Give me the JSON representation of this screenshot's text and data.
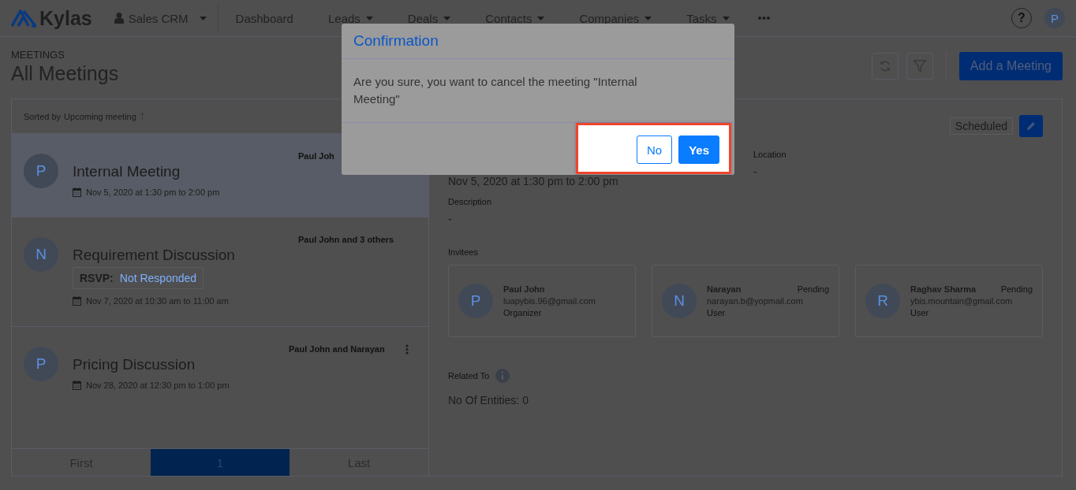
{
  "brand": {
    "name": "Kylas"
  },
  "workspace": {
    "label": "Sales CRM"
  },
  "nav": [
    {
      "label": "Dashboard",
      "dropdown": false
    },
    {
      "label": "Leads",
      "dropdown": true
    },
    {
      "label": "Deals",
      "dropdown": true
    },
    {
      "label": "Contacts",
      "dropdown": true
    },
    {
      "label": "Companies",
      "dropdown": true
    },
    {
      "label": "Tasks",
      "dropdown": true
    }
  ],
  "help": "?",
  "user": {
    "initial": "P"
  },
  "page": {
    "section": "MEETINGS",
    "title": "All Meetings",
    "add_button": "Add a Meeting"
  },
  "list": {
    "sort_label": "Sorted by",
    "sort_value": "Upcoming meeting",
    "meetings": [
      {
        "initial": "P",
        "title": "Internal Meeting",
        "participants": "Paul Joh",
        "date": "Nov 5, 2020 at 1:30 pm to 2:00 pm",
        "selected": true,
        "menu": false
      },
      {
        "initial": "N",
        "title": "Requirement Discussion",
        "participants": "Paul John and 3 others",
        "rsvp_label": "RSVP:",
        "rsvp_value": "Not Responded",
        "date": "Nov 7, 2020 at 10:30 am to 11:00 am",
        "selected": false,
        "menu": false
      },
      {
        "initial": "P",
        "title": "Pricing Discussion",
        "participants": "Paul John and Narayan",
        "date": "Nov 28, 2020 at 12:30 pm to 1:00 pm",
        "selected": false,
        "menu": true
      }
    ],
    "pages": [
      {
        "label": "First",
        "selected": false
      },
      {
        "label": "1",
        "selected": true
      },
      {
        "label": "Last",
        "selected": false
      }
    ]
  },
  "detail": {
    "status": "Scheduled",
    "date": "Nov 5, 2020 at 1:30 pm to 2:00 pm",
    "location_label": "Location",
    "location": "-",
    "description_label": "Description",
    "description": "-",
    "invitees_label": "Invitees",
    "invitees": [
      {
        "initial": "P",
        "name": "Paul John",
        "email": "luapybis.96@gmail.com",
        "role": "Organizer"
      },
      {
        "initial": "N",
        "name": "Narayan",
        "status": "Pending",
        "email": "narayan.b@yopmail.com",
        "role": "User"
      },
      {
        "initial": "R",
        "name": "Raghav Sharma",
        "status": "Pending",
        "email": "ybis.mountain@gmail.com",
        "role": "User"
      }
    ],
    "related_label": "Related To",
    "entities": "No Of Entities: 0"
  },
  "modal": {
    "title": "Confirmation",
    "message": "Are you sure, you want to cancel the meeting \"Internal Meeting\"",
    "buttons": [
      {
        "label": "No",
        "kind": "secondary"
      },
      {
        "label": "Yes",
        "kind": "primary"
      }
    ]
  }
}
